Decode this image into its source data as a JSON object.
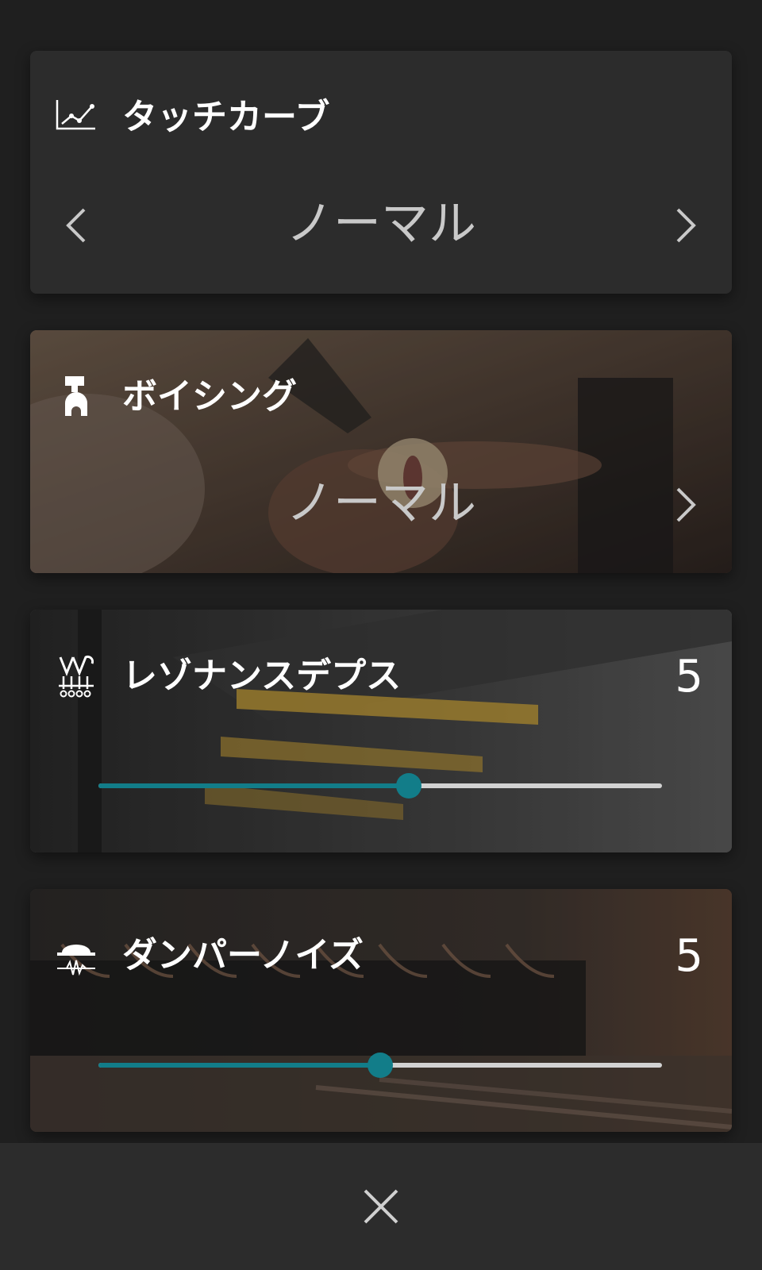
{
  "touch_curve": {
    "title": "タッチカーブ",
    "value": "ノーマル",
    "icon": "touch-curve-graph-icon"
  },
  "voicing": {
    "title": "ボイシング",
    "value": "ノーマル",
    "icon": "hammer-icon"
  },
  "resonance_depth": {
    "title": "レゾナンスデプス",
    "value": "5",
    "slider_fraction": 0.55,
    "icon": "resonance-strings-icon"
  },
  "damper_noise": {
    "title": "ダンパーノイズ",
    "value": "5",
    "slider_fraction": 0.5,
    "icon": "damper-noise-icon"
  },
  "footer": {
    "close_icon": "close-icon"
  },
  "colors": {
    "accent": "#127d89",
    "card_background": "#2c2c2c",
    "page_background": "#1f1f1f",
    "track": "#d2d2d2"
  }
}
